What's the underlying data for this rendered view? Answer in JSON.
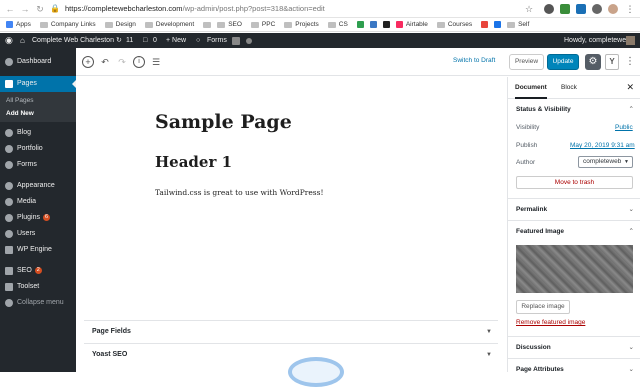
{
  "browser": {
    "url_host": "https://completewebcharleston.com",
    "url_path": "/wp-admin/post.php?post=318&action=edit",
    "bookmarks": [
      {
        "label": "Apps",
        "kind": "apps"
      },
      {
        "label": "Company Links",
        "kind": "folder"
      },
      {
        "label": "Design",
        "kind": "folder"
      },
      {
        "label": "Development",
        "kind": "folder"
      },
      {
        "label": "",
        "kind": "folder"
      },
      {
        "label": "SEO",
        "kind": "folder"
      },
      {
        "label": "PPC",
        "kind": "folder"
      },
      {
        "label": "Projects",
        "kind": "folder"
      },
      {
        "label": "CS",
        "kind": "folder"
      },
      {
        "label": "",
        "kind": "site-green"
      },
      {
        "label": "",
        "kind": "site-blue"
      },
      {
        "label": "",
        "kind": "site-x"
      },
      {
        "label": "Airtable",
        "kind": "site-airtable"
      },
      {
        "label": "Courses",
        "kind": "folder"
      },
      {
        "label": "",
        "kind": "site-red"
      },
      {
        "label": "",
        "kind": "site-blue2"
      },
      {
        "label": "Self",
        "kind": "folder"
      }
    ]
  },
  "adminbar": {
    "site_name": "Complete Web Charleston",
    "updates": "11",
    "comments": "0",
    "new_label": "+ New",
    "forms_label": "Forms",
    "greeting": "Howdy, completeweb"
  },
  "sidebar": {
    "items": [
      {
        "label": "Dashboard",
        "badge": ""
      },
      {
        "label": "Pages",
        "badge": ""
      },
      {
        "label": "All Pages",
        "badge": ""
      },
      {
        "label": "Add New",
        "badge": ""
      },
      {
        "label": "Blog",
        "badge": ""
      },
      {
        "label": "Portfolio",
        "badge": ""
      },
      {
        "label": "Forms",
        "badge": ""
      },
      {
        "label": "Appearance",
        "badge": ""
      },
      {
        "label": "Media",
        "badge": ""
      },
      {
        "label": "Plugins",
        "badge": "6"
      },
      {
        "label": "Users",
        "badge": ""
      },
      {
        "label": "WP Engine",
        "badge": ""
      },
      {
        "label": "SEO",
        "badge": "2"
      },
      {
        "label": "Toolset",
        "badge": ""
      },
      {
        "label": "Collapse menu",
        "badge": ""
      }
    ]
  },
  "toolbar": {
    "switch_draft": "Switch to Draft",
    "preview": "Preview",
    "update": "Update"
  },
  "content": {
    "title": "Sample Page",
    "heading": "Header 1",
    "paragraph": "Tailwind.css is great to use with WordPress!"
  },
  "metaboxes": [
    {
      "label": "Page Fields"
    },
    {
      "label": "Yoast SEO"
    }
  ],
  "panel": {
    "tab_document": "Document",
    "tab_block": "Block",
    "status_heading": "Status & Visibility",
    "visibility_label": "Visibility",
    "visibility_value": "Public",
    "publish_label": "Publish",
    "publish_value": "May 20, 2019 9:31 am",
    "author_label": "Author",
    "author_value": "completeweb",
    "trash": "Move to trash",
    "permalink": "Permalink",
    "featured_heading": "Featured Image",
    "replace_image": "Replace image",
    "remove_image": "Remove featured image",
    "discussion": "Discussion",
    "page_attributes": "Page Attributes"
  },
  "colors": {
    "admin_dark": "#23282d",
    "wp_blue": "#0073aa",
    "update_blue": "#0085ba",
    "trash_red": "#a00"
  }
}
